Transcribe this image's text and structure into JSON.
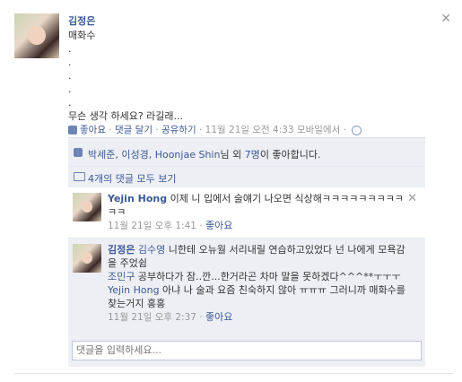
{
  "post": {
    "author": "김정은",
    "lines": [
      "매화수",
      ".",
      ".",
      ".",
      ".",
      ".",
      "무슨 생각 하세요? 라길래..."
    ],
    "actions": {
      "like": "좋아요",
      "comment": "댓글 달기",
      "share": "공유하기",
      "time": "11월 21일 오전 4:33 모바일에서"
    }
  },
  "likes": {
    "names": "박세준, 이성경, Hoonjae Shin",
    "suffix_pre": "님 외 ",
    "others": "7명",
    "suffix_post": "이 좋아합니다."
  },
  "view_all": "4개의 댓글 모두 보기",
  "comments": [
    {
      "name": "Yejin Hong",
      "text": "이제 니 입에서 술얘기 나오면 식상해ㅋㅋㅋㅋㅋㅋㅋㅋㅋㅋㅋ",
      "time": "11월 21일 오후 1:41",
      "like": "좋아요"
    },
    {
      "name": "김정은",
      "mention": "김수영",
      "text": " 니한테 오뉴월 서리내릴 연습하고있었다 넌 나에게 모욕감을 주었쉼",
      "mention2": "조민구",
      "text2": " 공부하다가 잠..깐...한거라곤 차마 말을 못하겠다^^^**ㅜㅜㅜ",
      "mention3": "Yejin Hong",
      "text3": " 아냐 나 술과 요즘 친숙하지 않아 ㅠㅠㅠ 그러니까 매화수를 찾는거지 홍홍",
      "time": "11월 21일 오후 2:37",
      "like": "좋아요"
    }
  ],
  "comment_placeholder": "댓글을 입력하세요..."
}
